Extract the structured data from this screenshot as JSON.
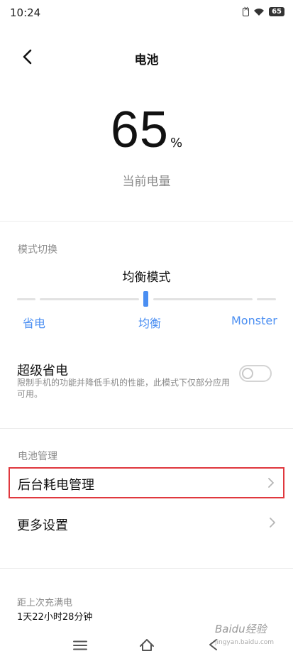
{
  "status_bar": {
    "time": "10:24",
    "battery": "65"
  },
  "header": {
    "title": "电池"
  },
  "battery": {
    "level": "65",
    "unit": "%",
    "caption": "当前电量"
  },
  "mode_section": {
    "label": "模式切换",
    "current_mode": "均衡模式",
    "options": [
      "省电",
      "均衡",
      "Monster"
    ],
    "selected_option": "均衡"
  },
  "super_saver": {
    "title": "超级省电",
    "description": "限制手机的功能并降低手机的性能，此模式下仅部分应用可用。",
    "enabled": false
  },
  "management_section": {
    "label": "电池管理",
    "items": [
      {
        "label": "后台耗电管理",
        "highlighted": true
      },
      {
        "label": "更多设置",
        "highlighted": false
      }
    ]
  },
  "footer": {
    "label": "距上次充满电",
    "value": "1天22小时28分钟"
  },
  "watermark": {
    "text": "Baidu经验",
    "sub": "jingyan.baidu.com"
  },
  "colors": {
    "accent": "#4a8ef2",
    "highlight_border": "#e0383e"
  }
}
